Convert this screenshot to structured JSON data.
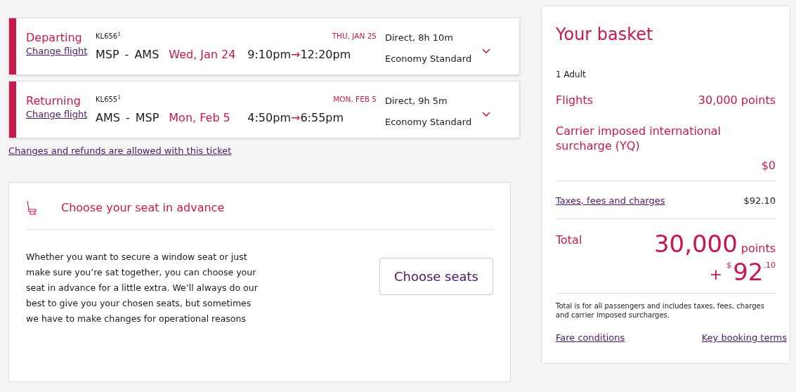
{
  "flights": [
    {
      "label": "Departing",
      "change_link": "Change flight",
      "flight_number": "KL656$^{1}$",
      "arrival_date": "THU, JAN 25",
      "origin": "MSP",
      "separator": "-",
      "destination": "AMS",
      "date": "Wed, Jan 24",
      "depart_time": "9:10pm",
      "arrow": "→",
      "arrive_time": "12:20pm",
      "duration": "Direct, 8h 10m",
      "cabin": "Economy Standard",
      "expanded": false
    },
    {
      "label": "Returning",
      "change_link": "Change flight",
      "flight_number": "KL655$^{1}$",
      "arrival_date": "MON, FEB 5",
      "origin": "AMS",
      "separator": "-",
      "destination": "MSP",
      "date": "Mon, Feb 5",
      "depart_time": "4:50pm",
      "arrow": "→",
      "arrive_time": "6:55pm",
      "duration": "Direct, 9h 5m",
      "cabin": "Economy Standard",
      "expanded": false
    }
  ],
  "refund_link": "Changes and refunds are allowed with this ticket",
  "seat_card": {
    "title": "Choose your seat in advance",
    "text": "Whether you want to secure a window seat or just make sure you’re sat together, you can choose your seat in advance for a little extra. We’ll always do our best to give you your chosen seats, but sometimes we have to make changes for operational reasons",
    "button": "Choose seats"
  },
  "basket": {
    "title": "Your basket",
    "passengers": "1 Adult",
    "flights_label": "Flights",
    "flights_value": "30,000 points",
    "surcharge_label": "Carrier imposed international surcharge (YQ)",
    "surcharge_value": "$0",
    "taxes_label": "Taxes, fees and charges",
    "taxes_value": "$92.10",
    "total_label": "Total",
    "total_points": "30,000",
    "points_unit": "points",
    "plus": "+",
    "currency": "$",
    "amount": "92",
    "cents": ".10",
    "note": "Total is for all passengers and includes taxes, fees, charges and carrier imposed surcharges.",
    "links": [
      "Fare conditions",
      "Key booking terms"
    ]
  }
}
